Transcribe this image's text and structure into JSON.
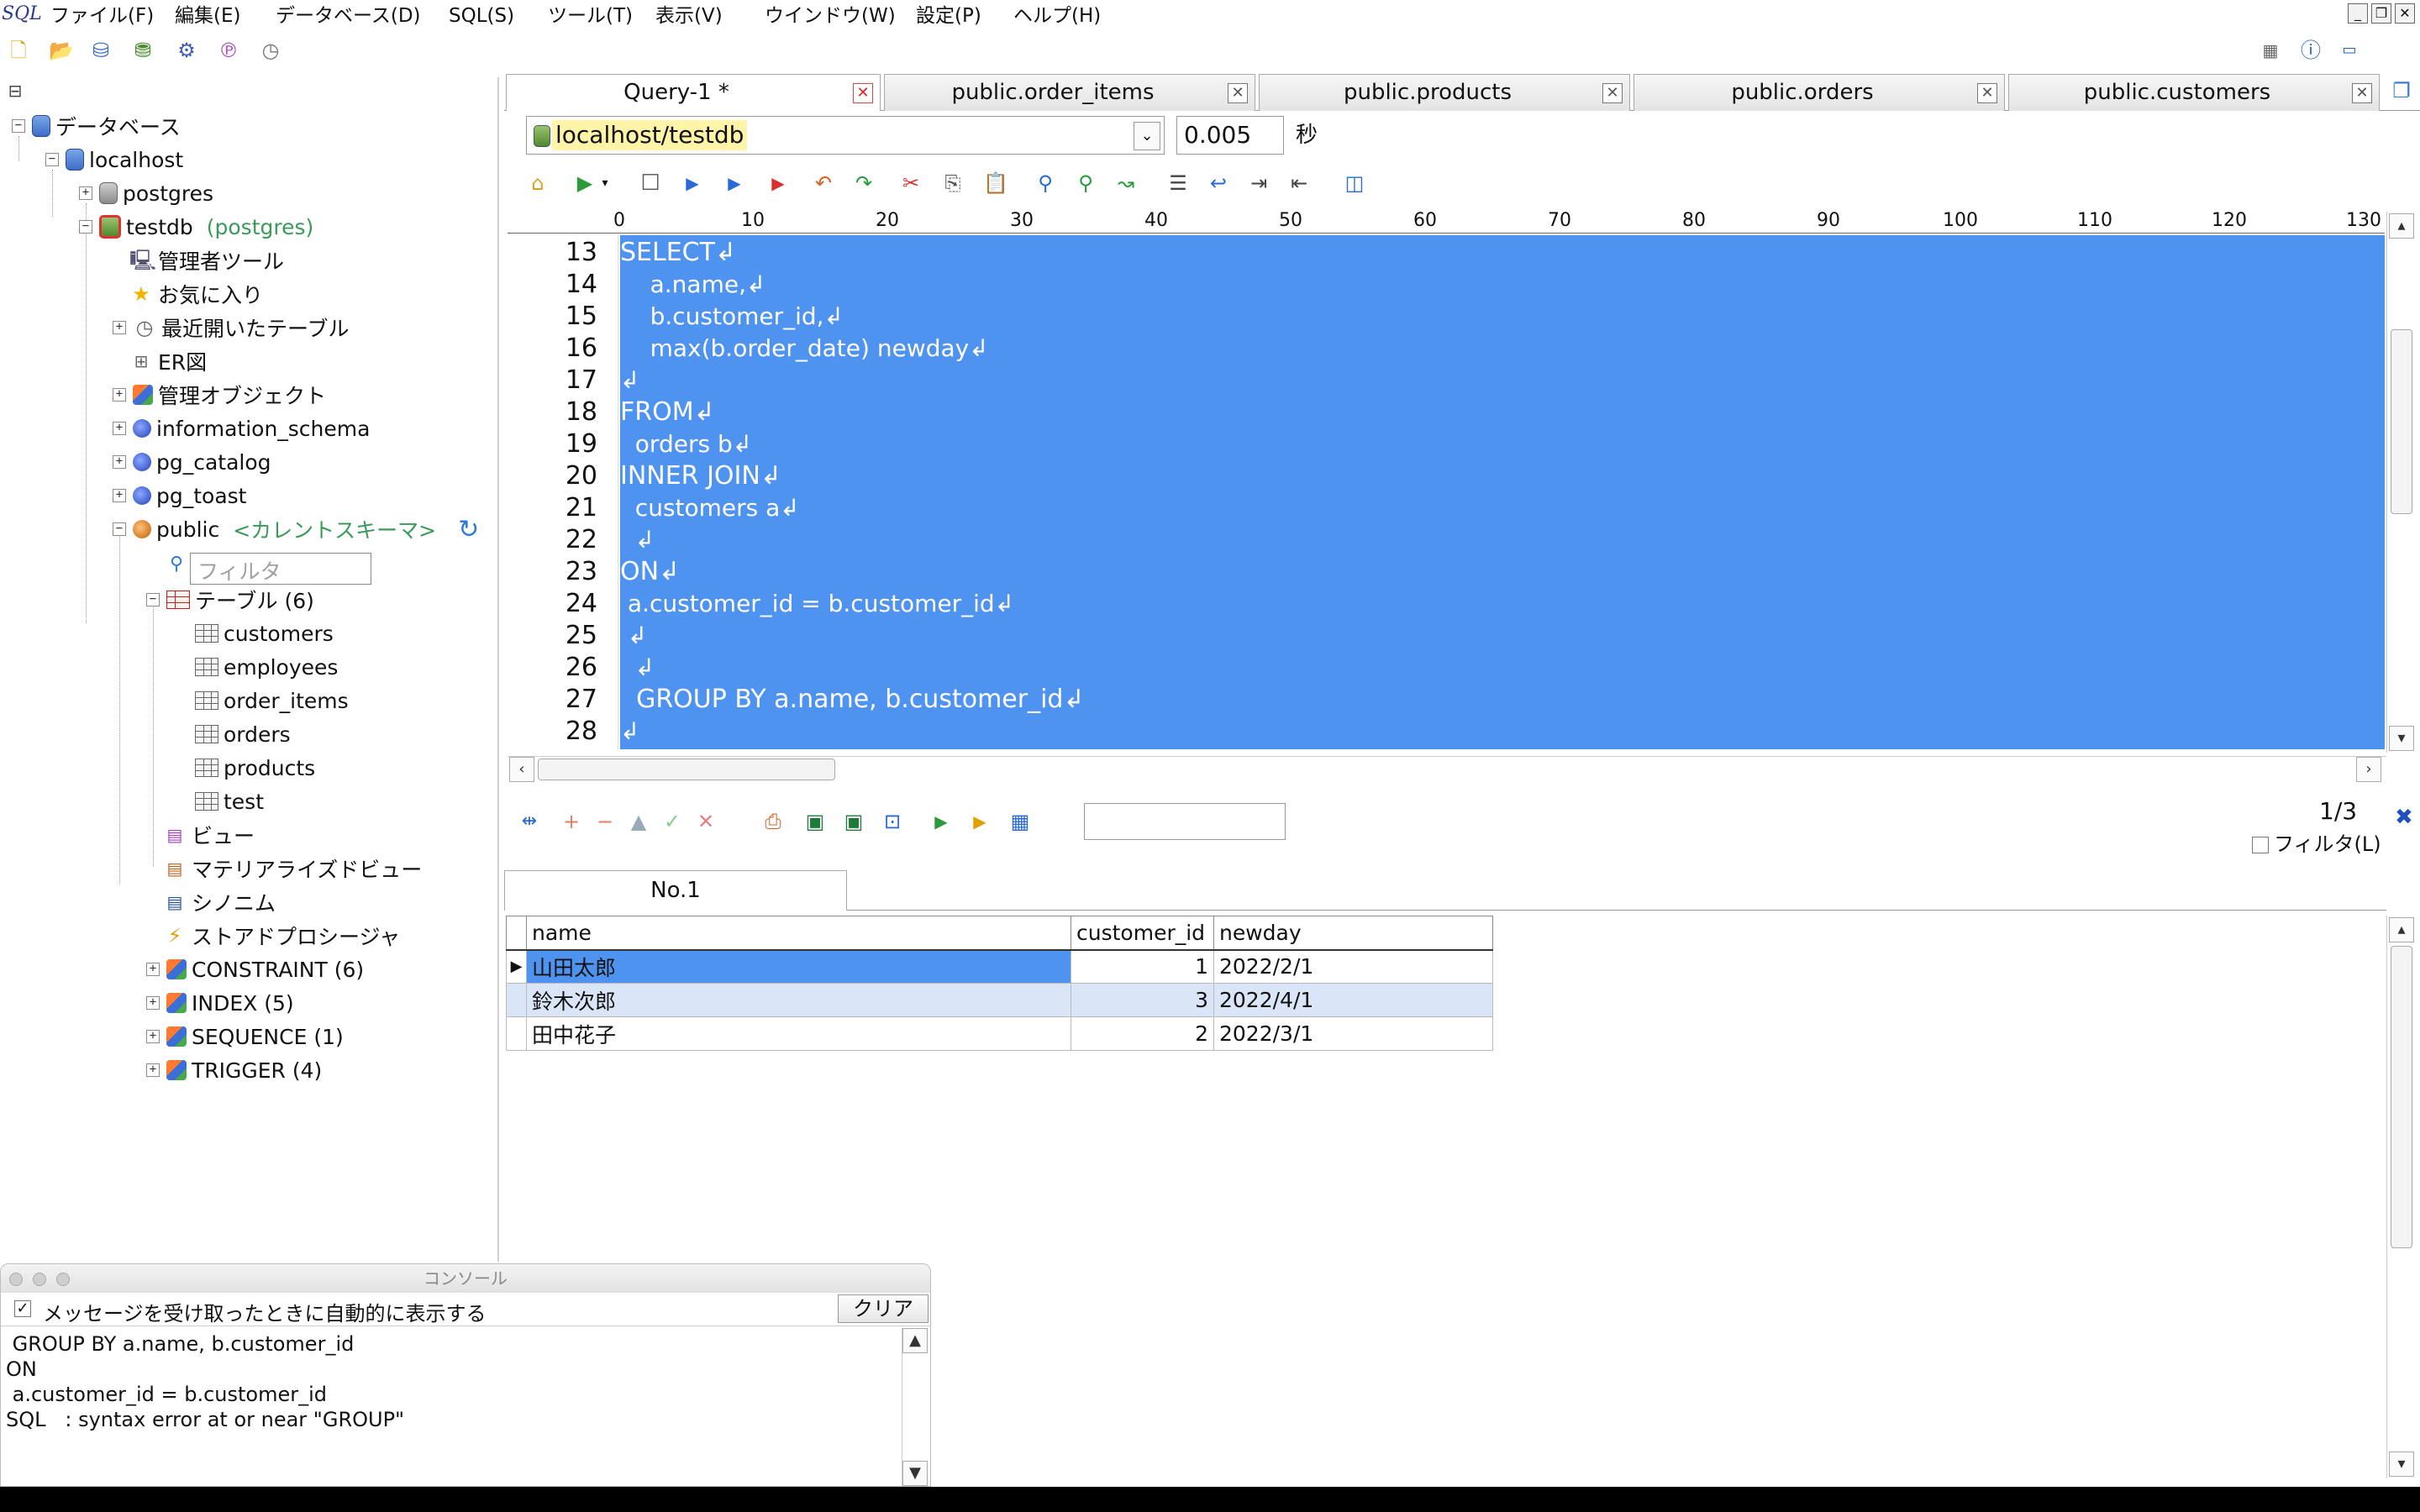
{
  "menu": {
    "logo": "SQL",
    "items": [
      "ファイル(F)",
      "編集(E)",
      "データベース(D)",
      "SQL(S)",
      "ツール(T)",
      "表示(V)",
      "ウインドウ(W)",
      "設定(P)",
      "ヘルプ(H)"
    ]
  },
  "main_toolbar_icons": [
    "new-file-icon",
    "open-folder-icon",
    "database-icon",
    "database-table-icon",
    "gear-icon",
    "plugin-icon",
    "history-icon"
  ],
  "tree": {
    "root": "データベース",
    "host": "localhost",
    "db_postgres": "postgres",
    "db_testdb": "testdb",
    "db_testdb_owner": "(postgres)",
    "admin_tools": "管理者ツール",
    "favorites": "お気に入り",
    "recent_tables": "最近開いたテーブル",
    "er_diagram": "ER図",
    "admin_objects": "管理オブジェクト",
    "schema_info": "information_schema",
    "schema_catalog": "pg_catalog",
    "schema_toast": "pg_toast",
    "schema_public": "public",
    "current_schema": "<カレントスキーマ>",
    "filter_placeholder": "フィルタ",
    "tables_label": "テーブル (6)",
    "tables": [
      "customers",
      "employees",
      "order_items",
      "orders",
      "products",
      "test"
    ],
    "views": "ビュー",
    "mat_views": "マテリアライズドビュー",
    "synonyms": "シノニム",
    "procedures": "ストアドプロシージャ",
    "constraint": "CONSTRAINT (6)",
    "index": "INDEX (5)",
    "sequence": "SEQUENCE (1)",
    "trigger": "TRIGGER (4)"
  },
  "console": {
    "title": "コンソール",
    "auto_show_label": "メッセージを受け取ったときに自動的に表示する",
    "auto_show_checked": true,
    "clear_label": "クリア",
    "lines": [
      " GROUP BY a.name, b.customer_id",
      "",
      "ON",
      " a.customer_id = b.customer_id",
      "SQL   : syntax error at or near \"GROUP\""
    ]
  },
  "tabs": [
    {
      "label": "Query-1 *",
      "active": true
    },
    {
      "label": "public.order_items",
      "active": false
    },
    {
      "label": "public.products",
      "active": false
    },
    {
      "label": "public.orders",
      "active": false
    },
    {
      "label": "public.customers",
      "active": false
    }
  ],
  "connection": {
    "value": "localhost/testdb",
    "elapsed": "0.005",
    "unit": "秒"
  },
  "ruler": [
    "0",
    "10",
    "20",
    "30",
    "40",
    "50",
    "60",
    "70",
    "80",
    "90",
    "100",
    "110",
    "120",
    "130"
  ],
  "editor": {
    "selection_color": "#4f93f0",
    "line_numbers": [
      "13",
      "14",
      "15",
      "16",
      "17",
      "18",
      "19",
      "20",
      "21",
      "22",
      "23",
      "24",
      "25",
      "26",
      "27",
      "28"
    ],
    "lines": [
      "SELECT↲",
      "    a.name,↲",
      "    b.customer_id,↲",
      "    max(b.order_date) newday↲",
      "↲",
      "FROM↲",
      "  orders b↲",
      "INNER JOIN↲",
      "  customers a↲",
      "  ↲",
      "ON↲",
      " a.customer_id = b.customer_id↲",
      " ↲",
      "  ↲",
      "  GROUP BY a.name, b.customer_id↲",
      "↲"
    ]
  },
  "results": {
    "pager": "1/3",
    "filter_label": "フィルタ(L)",
    "tab_label": "No.1",
    "columns": [
      "name",
      "customer_id",
      "newday"
    ],
    "rows": [
      {
        "name": "山田太郎",
        "customer_id": "1",
        "newday": "2022/2/1"
      },
      {
        "name": "鈴木次郎",
        "customer_id": "3",
        "newday": "2022/4/1"
      },
      {
        "name": "田中花子",
        "customer_id": "2",
        "newday": "2022/3/1"
      }
    ]
  }
}
